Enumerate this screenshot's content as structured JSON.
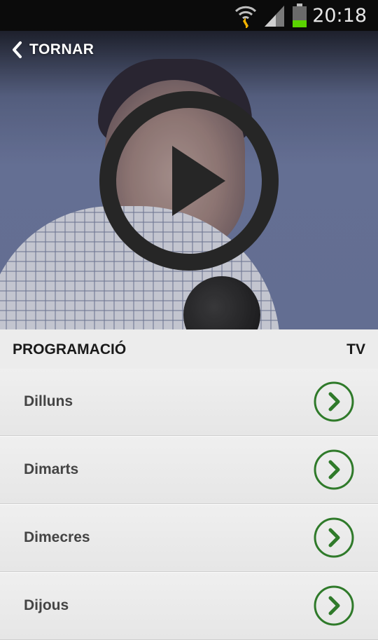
{
  "status_bar": {
    "time": "20:18",
    "icons": [
      "wifi-icon",
      "signal-icon",
      "battery-icon"
    ],
    "battery_color": "#5ad300"
  },
  "header": {
    "back_label": "TORNAR"
  },
  "video": {
    "play_icon": "play-icon"
  },
  "section": {
    "title": "PROGRAMACIÓ",
    "right_label": "TV"
  },
  "days": [
    {
      "label": "Dilluns"
    },
    {
      "label": "Dimarts"
    },
    {
      "label": "Dimecres"
    },
    {
      "label": "Dijous"
    }
  ],
  "colors": {
    "accent_green": "#2f7a2a",
    "status_bar_bg": "#0b0b0b",
    "list_bg": "#ececec"
  }
}
